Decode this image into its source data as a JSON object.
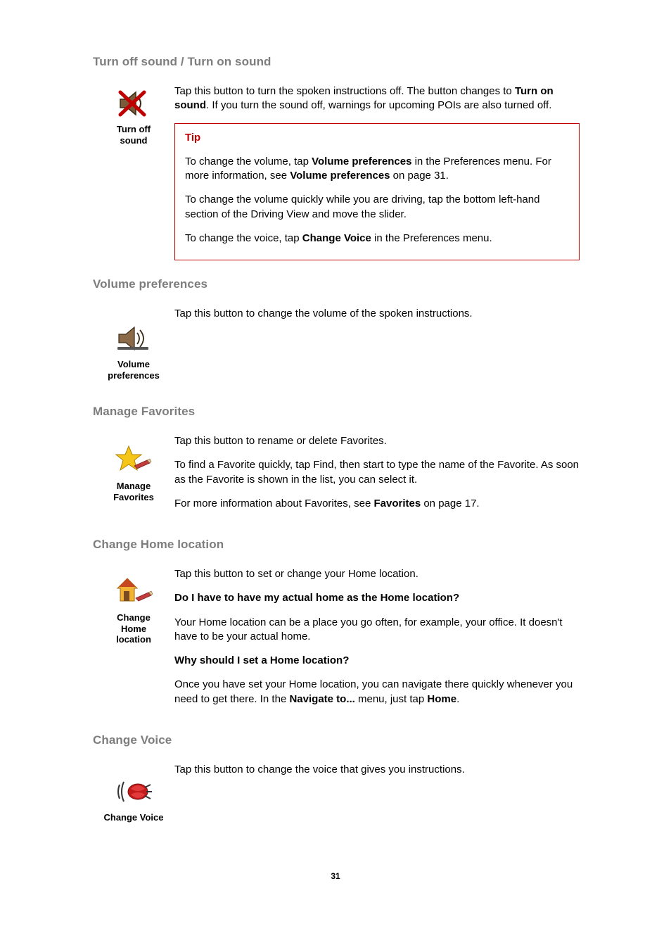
{
  "page_number": "31",
  "sections": {
    "turn_off_sound": {
      "heading": "Turn off sound / Turn on sound",
      "icon_label_l1": "Turn off",
      "icon_label_l2": "sound",
      "intro_pre": "Tap this button to turn the spoken instructions off. The button changes to ",
      "intro_bold": "Turn on sound",
      "intro_post": ". If you turn the sound off, warnings for upcoming POIs are also turned off.",
      "tip_label": "Tip",
      "tip_p1_a": "To change the volume, tap ",
      "tip_p1_b": "Volume preferences",
      "tip_p1_c": " in the Preferences menu. For more information, see ",
      "tip_p1_d": "Volume preferences",
      "tip_p1_e": " on page 31.",
      "tip_p2": "To change the volume quickly while you are driving, tap the bottom left-hand section of the Driving View and move the slider.",
      "tip_p3_a": "To change the voice, tap ",
      "tip_p3_b": "Change Voice",
      "tip_p3_c": " in the Preferences menu."
    },
    "volume_prefs": {
      "heading": "Volume preferences",
      "icon_label_l1": "Volume",
      "icon_label_l2": "preferences",
      "p1": "Tap this button to change the volume of the spoken instructions."
    },
    "manage_fav": {
      "heading": "Manage Favorites",
      "icon_label_l1": "Manage",
      "icon_label_l2": "Favorites",
      "p1": "Tap this button to rename or delete Favorites.",
      "p2": "To find a Favorite quickly, tap Find, then start to type the name of the Favorite. As soon as the Favorite is shown in the list, you can select it.",
      "p3_a": "For more information about Favorites, see ",
      "p3_b": "Favorites",
      "p3_c": " on page 17."
    },
    "change_home": {
      "heading": "Change Home location",
      "icon_label_l1": "Change",
      "icon_label_l2": "Home",
      "icon_label_l3": "location",
      "p1": "Tap this button to set or change your Home location.",
      "q1": "Do I have to have my actual home as the Home location?",
      "p2": "Your Home location can be a place you go often, for example, your office. It doesn't have to be your actual home.",
      "q2": "Why should I set a Home location?",
      "p3_a": "Once you have set your Home location, you can navigate there quickly whenever you need to get there. In the ",
      "p3_b": "Navigate to...",
      "p3_c": " menu, just tap ",
      "p3_d": "Home",
      "p3_e": "."
    },
    "change_voice": {
      "heading": "Change Voice",
      "icon_label": "Change Voice",
      "p1": "Tap this button to change the voice that gives you instructions."
    }
  }
}
